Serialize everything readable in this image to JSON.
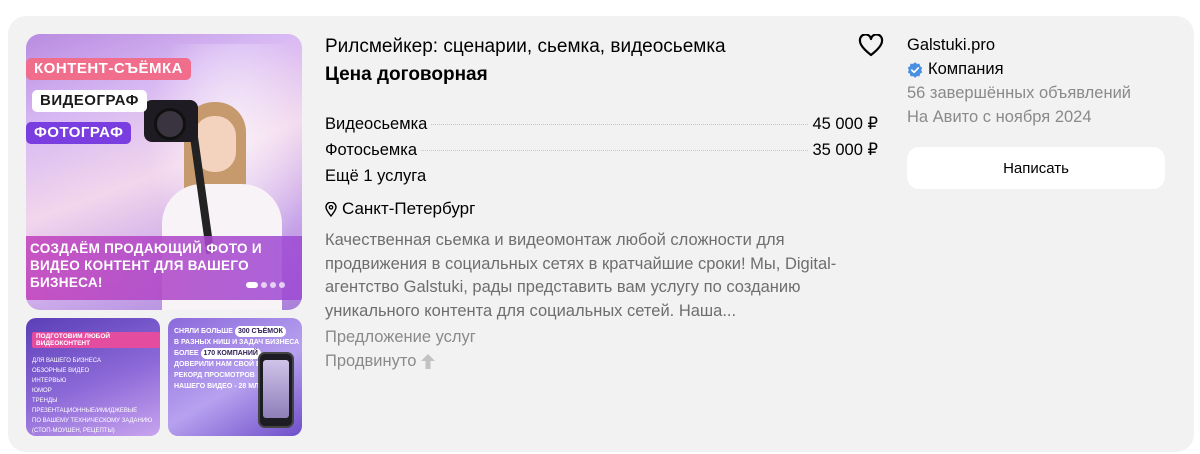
{
  "gallery": {
    "main_badges": [
      "КОНТЕНТ-СЪЁМКА",
      "ВИДЕОГРАФ",
      "ФОТОГРАФ"
    ],
    "main_banner": "СОЗДАЁМ ПРОДАЮЩИЙ ФОТО И ВИДЕО КОНТЕНТ ДЛЯ ВАШЕГО БИЗНЕСА!",
    "thumb1_heading": "ПОДГОТОВИМ ЛЮБОЙ ВИДЕОКОНТЕНТ",
    "thumb1_lines": [
      "ДЛЯ ВАШЕГО БИЗНЕСА",
      "ОБЗОРНЫЕ ВИДЕО",
      "ИНТЕРВЬЮ",
      "ЮМОР",
      "ТРЕНДЫ",
      "ПРЕЗЕНТАЦИОННЫЕ/ИМИДЖЕВЫЕ",
      "ПО ВАШЕМУ ТЕХНИЧЕСКОМУ ЗАДАНИЮ",
      "(СТОП-МОУШЕН, РЕЦЕПТЫ)"
    ],
    "thumb2_top": "СНЯЛИ БОЛЬШЕ",
    "thumb2_pill": "300 СЪЁМОК",
    "thumb2_line2": "В РАЗНЫХ НИШ И ЗАДАЧ БИЗНЕСА",
    "thumb2_line3": "БОЛЕЕ",
    "thumb2_pill2": "170 КОМПАНИЙ",
    "thumb2_line4": "ДОВЕРИЛИ НАМ СВОЙ БИЗНЕС",
    "thumb2_line5": "РЕКОРД ПРОСМОТРОВ",
    "thumb2_line6": "НАШЕГО ВИДЕО - 28 МЛН."
  },
  "listing": {
    "title": "Рилсмейкер: сценарии, сьемка, видеосьемка",
    "price": "Цена договорная",
    "services": [
      {
        "name": "Видеосьемка",
        "price": "45 000 ₽"
      },
      {
        "name": "Фотосьемка",
        "price": "35 000 ₽"
      }
    ],
    "more_services": "Ещё 1 услуга",
    "location": "Санкт-Петербург",
    "description": "Качественная сьемка и видеомонтаж любой сложности для продвижения в социальных сетях в кратчайшие сроки! Мы, Digital-агентство Galstuki, рады представить вам услугу по созданию уникального контента для социальных сетей. Наша...",
    "service_type": "Предложение услуг",
    "promoted": "Продвинуто"
  },
  "seller": {
    "name": "Galstuki.pro",
    "type": "Компания",
    "deals": "56 завершённых объявлений",
    "since": "На Авито с ноября 2024",
    "write_button": "Написать"
  },
  "colors": {
    "card_bg": "#f2f2f2",
    "verified": "#4a90e2",
    "muted_text": "#8a8a8a",
    "desc_text": "#6e6e6e"
  },
  "icons": [
    "heart-icon",
    "location-pin-icon",
    "verified-icon",
    "arrow-up-icon"
  ]
}
